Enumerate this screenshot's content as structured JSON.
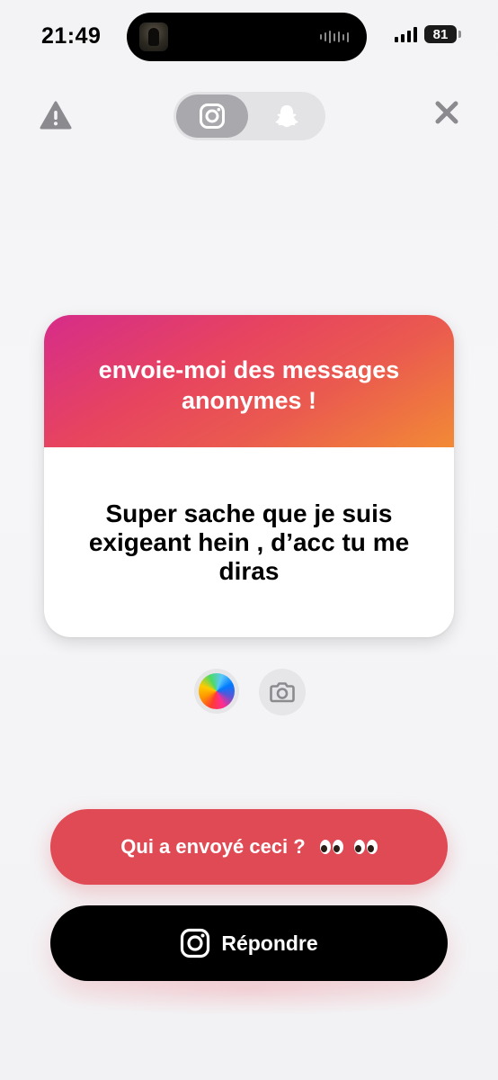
{
  "status_bar": {
    "time": "21:49",
    "battery": "81"
  },
  "header": {
    "warning_icon": "warning-triangle-icon",
    "close_icon": "close-x-icon",
    "platforms": [
      {
        "name": "instagram",
        "icon": "instagram-icon",
        "selected": true
      },
      {
        "name": "snapchat",
        "icon": "snapchat-ghost-icon",
        "selected": false
      }
    ]
  },
  "card": {
    "prompt": "envoie-moi des messages anonymes !",
    "message": "Super sache que je suis exigeant hein , d’acc tu me diras"
  },
  "style_controls": {
    "color_icon": "color-wheel-icon",
    "camera_icon": "camera-icon"
  },
  "buttons": {
    "who_sent_label": "Qui a envoyé ceci ?",
    "who_sent_emoji": "eyes-emoji",
    "reply_label": "Répondre",
    "reply_icon": "instagram-icon"
  },
  "colors": {
    "who_sent_bg": "#e04a55",
    "reply_bg": "#000000",
    "gradient_start": "#d62c8a",
    "gradient_end": "#f28a35"
  }
}
